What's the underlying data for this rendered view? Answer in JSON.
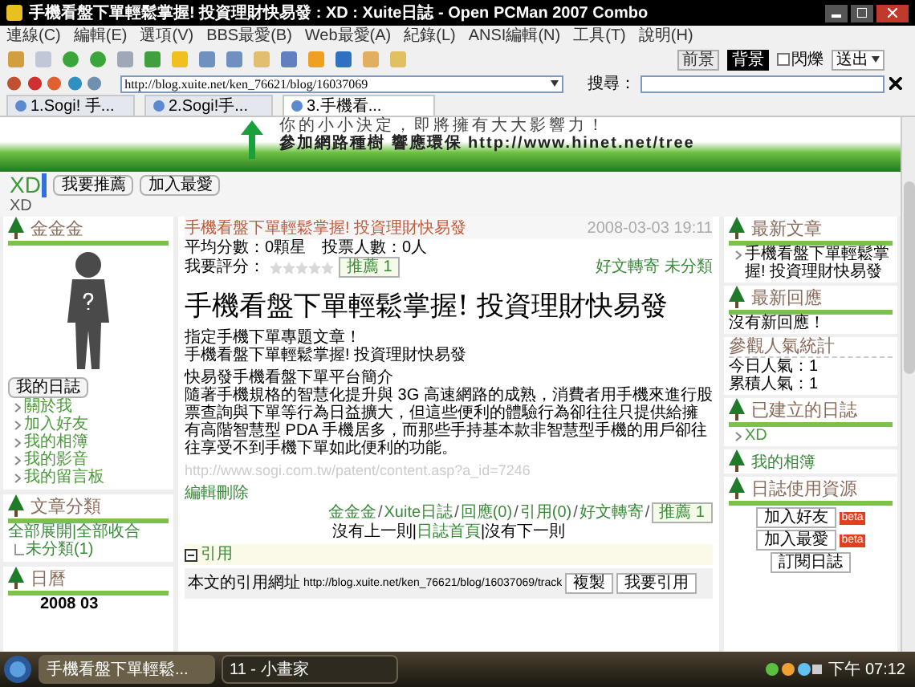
{
  "window": {
    "title": "手機看盤下單輕鬆掌握! 投資理財快易發 : XD : Xuite日誌 - Open PCMan 2007 Combo"
  },
  "menu": [
    "連線(C)",
    "編輯(E)",
    "選項(V)",
    "BBS最愛(B)",
    "Web最愛(A)",
    "紀錄(L)",
    "ANSI編輯(N)",
    "工具(T)",
    "說明(H)"
  ],
  "toolbar": {
    "modes": [
      {
        "label": "前景",
        "selected": false
      },
      {
        "label": "背景",
        "selected": true
      }
    ],
    "blink": {
      "label": "閃爍",
      "checked": false
    },
    "send": "送出"
  },
  "address": {
    "value": "http://blog.xuite.net/ken_76621/blog/16037069",
    "search_label": "搜尋："
  },
  "tabs": [
    {
      "label": "1.Sogi! 手...",
      "selected": false
    },
    {
      "label": "2.Sogi!手...",
      "selected": false
    },
    {
      "label": "3.手機看...",
      "selected": true
    }
  ],
  "banner": {
    "slogan": "你的小小決定，即將擁有大大影響力！",
    "line": "參加網路種樹 響應環保 http://www.hinet.net/tree"
  },
  "blog_header": {
    "name": "XD",
    "buttons": [
      "我要推薦",
      "加入最愛"
    ],
    "subtitle": "XD"
  },
  "left": {
    "profile_title": "金金金",
    "diary_button": "我的日誌",
    "links": [
      "關於我",
      "加入好友",
      "我的相簿",
      "我的影音",
      "我的留言板"
    ],
    "category_title": "文章分類",
    "expand": "全部展開",
    "separator": "|",
    "collapse": "全部收合",
    "categories": [
      "未分類(1)"
    ],
    "calendar_title": "日曆",
    "calendar_month": "2008 03"
  },
  "post": {
    "header_title": "手機看盤下單輕鬆掌握! 投資理財快易發",
    "date": "2008-03-03 19:11",
    "score": "平均分數：0顆星　投票人數：0人",
    "rate_label": "我要評分：",
    "stars": 0,
    "recommend": "推薦 1",
    "forward": "好文轉寄",
    "category": "未分類",
    "title": "手機看盤下單輕鬆掌握! 投資理財快易發",
    "intro": [
      "指定手機下單專題文章！",
      "手機看盤下單輕鬆掌握! 投資理財快易發"
    ],
    "section": "快易發手機看盤下單平台簡介",
    "body": "隨著手機規格的智慧化提升與 3G 高速網路的成熟，消費者用手機來進行股票查詢與下單等行為日益擴大，但這些便利的體驗行為卻往往只提供給擁有高階智慧型 PDA 手機居多，而那些手持基本款非智慧型手機的用戶卻往往享受不到手機下單如此便利的功能。",
    "source": "http://www.sogi.com.tw/patent/content.asp?a_id=7246",
    "edit": "編輯刪除",
    "footer_links": [
      "金金金",
      "Xuite日誌",
      "回應(0)",
      "引用(0)",
      "好文轉寄"
    ],
    "footer_separator": "/",
    "nav_separator": "|",
    "footer_recommend": "推薦 1",
    "nav": [
      "沒有上一則",
      "日誌首頁",
      "沒有下一則"
    ],
    "trackback_title": "引用",
    "trackback_label": "本文的引用網址",
    "trackback_url": "http://blog.xuite.net/ken_76621/blog/16037069/track",
    "trackback_buttons": [
      "複製",
      "我要引用"
    ]
  },
  "right": {
    "latest_title": "最新文章",
    "latest": [
      "手機看盤下單輕鬆掌握! 投資理財快易發"
    ],
    "replies_title": "最新回應",
    "replies_empty": "沒有新回應！",
    "stats_title": "參觀人氣統計",
    "stats": [
      "今日人氣：1",
      "累積人氣：1"
    ],
    "blogs_title": "已建立的日誌",
    "blogs": [
      "XD"
    ],
    "album": "我的相簿",
    "resources_title": "日誌使用資源",
    "resources": [
      {
        "label": "加入好友",
        "badge": "beta"
      },
      {
        "label": "加入最愛",
        "badge": "beta"
      },
      {
        "label": "訂閱日誌"
      }
    ]
  },
  "taskbar": {
    "windows": [
      {
        "label": "手機看盤下單輕鬆...",
        "selected": true
      },
      {
        "label": "11 - 小畫家",
        "selected": false
      }
    ],
    "clock": "下午 07:12"
  }
}
